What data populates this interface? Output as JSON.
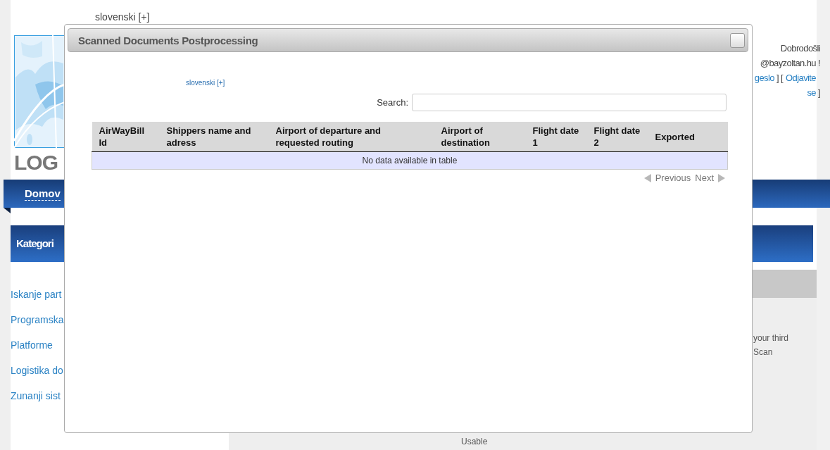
{
  "page_header": {
    "language_link": "slovenski [+]",
    "logo_text": "LOG",
    "welcome": "Dobrodošli",
    "user": "@bayzoltan.hu !",
    "password_link": "geslo",
    "separator": " ] [ ",
    "logout_link": "Odjavite se",
    "closing_bracket": " ]"
  },
  "nav": {
    "items": [
      {
        "label": "Domov",
        "selected": true
      }
    ]
  },
  "sidebar": {
    "title": "Kategori",
    "items": [
      "Iskanje part",
      "Programska",
      "Platforme",
      "Logistika do",
      "Zunanji sist"
    ]
  },
  "content": {
    "lines": [
      "your third",
      "Scan"
    ],
    "footer": "Usable"
  },
  "dialog": {
    "title": "Scanned Documents Postprocessing",
    "language_link": "slovenski [+]",
    "search": {
      "label": "Search:"
    },
    "table": {
      "columns": [
        "AirWayBill Id",
        "Shippers name and adress",
        "Airport of departure and requested routing",
        "Airport of destination",
        "Flight date 1",
        "Flight date 2",
        "Exported"
      ],
      "empty_message": "No data available in table"
    },
    "pagination": {
      "previous": "Previous",
      "next": "Next"
    }
  }
}
